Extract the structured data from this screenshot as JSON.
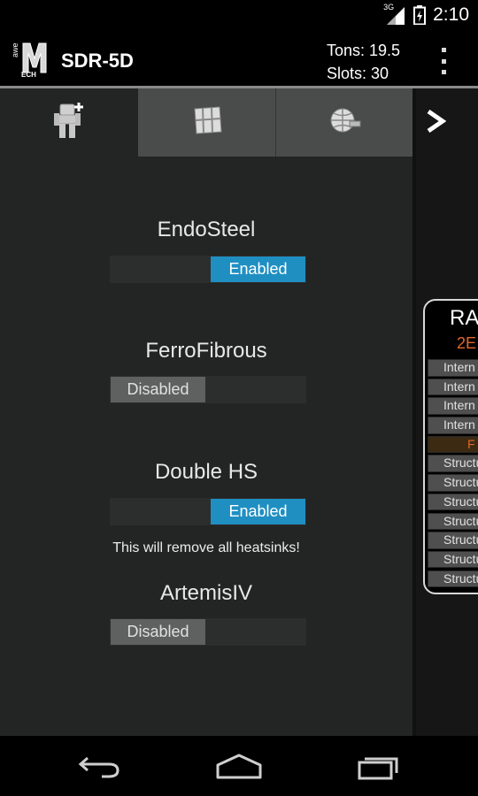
{
  "status_bar": {
    "network_label": "3G",
    "time": "2:10",
    "icons": [
      "signal-icon",
      "battery-icon"
    ]
  },
  "action_bar": {
    "logo_icon": "awemech-logo",
    "title": "SDR-5D",
    "tons_text": "Tons: 19.5",
    "slots_text": "Slots: 30",
    "overflow_icon": "overflow-menu-icon"
  },
  "tabs": [
    {
      "icon": "mech-add-icon",
      "active": true
    },
    {
      "icon": "armor-plate-icon",
      "active": false
    },
    {
      "icon": "weapons-globe-icon",
      "active": false
    }
  ],
  "next_icon": "chevron-right-icon",
  "options": [
    {
      "label": "EndoSteel",
      "state": "Enabled",
      "on": true
    },
    {
      "label": "FerroFibrous",
      "state": "Disabled",
      "on": false
    },
    {
      "label": "Double HS",
      "state": "Enabled",
      "on": true,
      "warning": "This will remove all heatsinks!"
    },
    {
      "label": "ArtemisIV",
      "state": "Disabled",
      "on": false
    }
  ],
  "location_card": {
    "name": "RA",
    "sub": "2E",
    "rows": [
      "Intern",
      "Intern",
      "Intern",
      "Intern",
      "F",
      "Structu",
      "Structu",
      "Structu",
      "Structu",
      "Structu",
      "Structu",
      "Structu"
    ]
  },
  "nav": {
    "back_icon": "back-icon",
    "home_icon": "home-icon",
    "recents_icon": "recents-icon"
  },
  "colors": {
    "accent_blue": "#1f8fc2",
    "accent_orange": "#e0672b",
    "panel_bg": "#222523",
    "tab_inactive": "#4a4c4b"
  }
}
